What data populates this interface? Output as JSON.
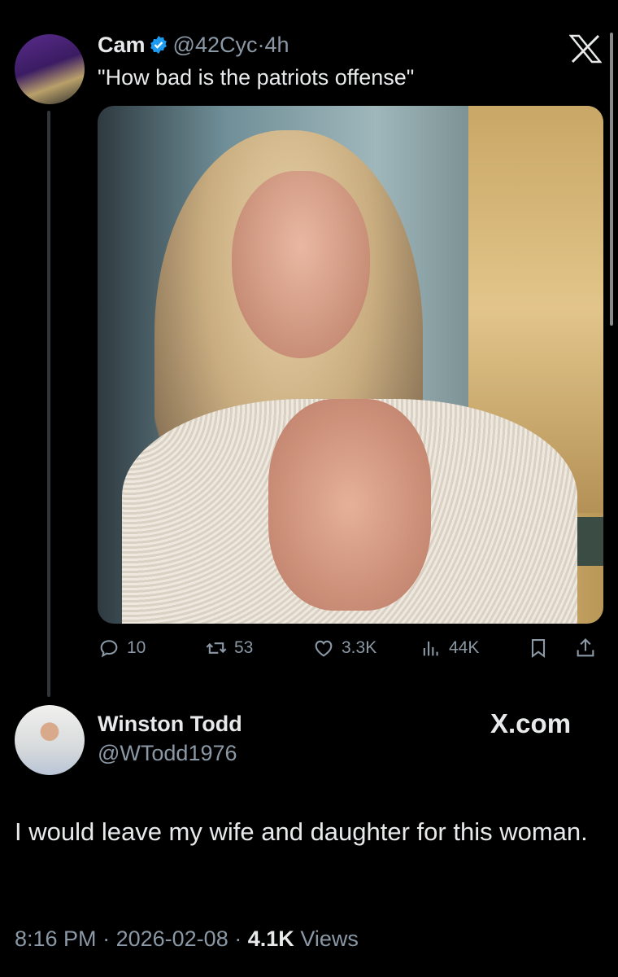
{
  "tweet": {
    "author_name": "Cam",
    "author_handle": "@42Cyc",
    "separator": "·",
    "time_ago": "4h",
    "text": "\"How bad is the patriots offense\"",
    "stats": {
      "replies": "10",
      "reposts": "53",
      "likes": "3.3K",
      "views": "44K"
    }
  },
  "reply": {
    "author_name": "Winston Todd",
    "author_handle": "@WTodd1976",
    "watermark": "X.com",
    "text": "I would leave my wife and daughter for this woman.",
    "time": "8:16 PM",
    "date": "2026-02-08",
    "views_count": "4.1K",
    "views_label": "Views",
    "separator": "·"
  },
  "colors": {
    "background": "#000000",
    "primary_text": "#e7e9ea",
    "secondary_text": "#8b98a5",
    "verified_badge": "#1d9bf0"
  },
  "icons": [
    "verified-icon",
    "x-logo-icon",
    "reply-icon",
    "repost-icon",
    "like-icon",
    "views-icon",
    "bookmark-icon",
    "share-icon"
  ]
}
